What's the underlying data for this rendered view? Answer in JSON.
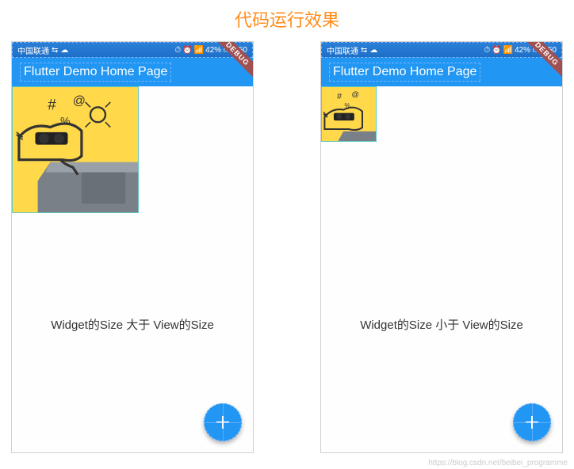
{
  "title": "代码运行效果",
  "statusbar": {
    "carrier": "中国联通",
    "battery": "42%",
    "time": "6:50"
  },
  "appbar": {
    "title": "Flutter Demo Home Page",
    "debug": "DEBUG"
  },
  "screens": [
    {
      "caption": "Widget的Size 大于 View的Size",
      "large": true
    },
    {
      "caption": "Widget的Size 小于 View的Size",
      "large": false
    }
  ],
  "watermark": "https://blog.csdn.net/beibei_programme"
}
